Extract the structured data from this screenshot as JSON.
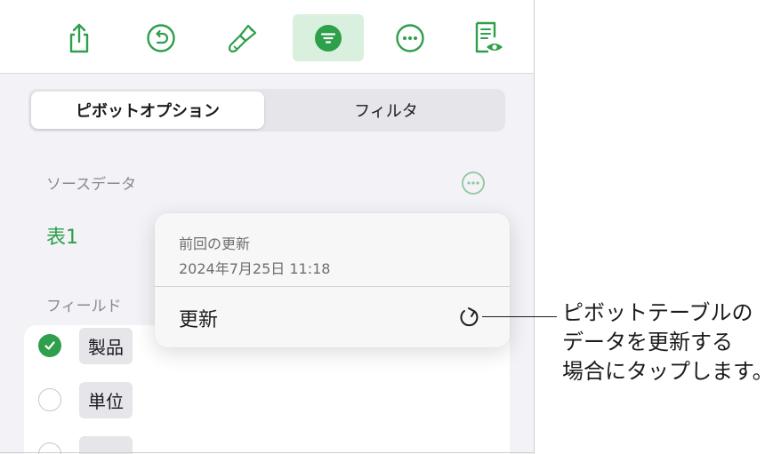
{
  "toolbar": {
    "buttons": [
      {
        "icon": "share-icon"
      },
      {
        "icon": "undo-icon"
      },
      {
        "icon": "format-brush-icon"
      },
      {
        "icon": "organize-icon",
        "active": true
      },
      {
        "icon": "more-icon"
      },
      {
        "icon": "document-view-icon"
      }
    ]
  },
  "tabs": [
    {
      "label": "ピボットオプション",
      "selected": true
    },
    {
      "label": "フィルタ",
      "selected": false
    }
  ],
  "source": {
    "label": "ソースデータ",
    "table_name": "表1"
  },
  "fields": {
    "label": "フィールド",
    "items": [
      {
        "name": "製品",
        "checked": true
      },
      {
        "name": "単位",
        "checked": false
      },
      {
        "name": "",
        "checked": false
      }
    ]
  },
  "popover": {
    "caption": "前回の更新",
    "date": "2024年7月25日 11:18",
    "action": "更新"
  },
  "callout": {
    "lines": [
      "ピボットテーブルの",
      "データを更新する",
      "場合にタップします。"
    ]
  },
  "colors": {
    "accent": "#2e9f4a",
    "active_button_bg": "#d8f0dd"
  }
}
